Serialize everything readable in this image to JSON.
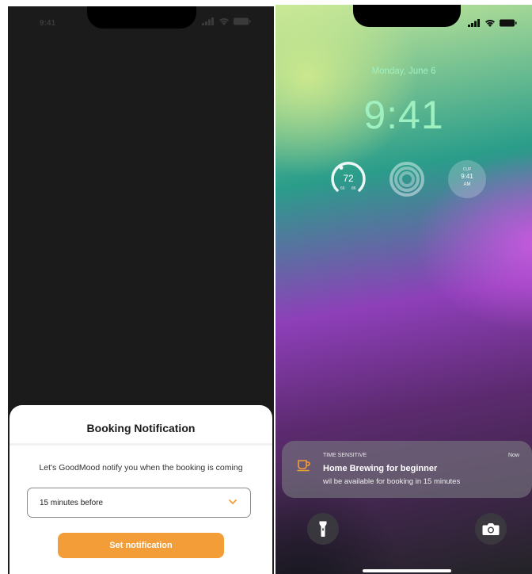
{
  "left_screen": {
    "status_time": "9:41",
    "sheet": {
      "title": "Booking Notification",
      "description": "Let's GoodMood notify you when the booking is coming",
      "select_value": "15 minutes before",
      "button_label": "Set notification"
    },
    "colors": {
      "accent": "#f29d38",
      "background": "#1b1b1b"
    }
  },
  "right_screen": {
    "date": "Monday, June 6",
    "time": "9:41",
    "widgets": {
      "temperature": {
        "value": "72",
        "low": "66",
        "high": "86"
      },
      "world_clock": {
        "city": "CUP",
        "time": "9:41",
        "ampm": "AM"
      }
    },
    "notification": {
      "tag": "TIME SENSITIVE",
      "when": "Now",
      "title": "Home Brewing for beginner",
      "body": "wil be available for booking in 15 minutes",
      "icon": "coffee-cup-icon"
    },
    "colors": {
      "clock": "#9ff0c0",
      "notification_icon": "#f29d38"
    }
  }
}
